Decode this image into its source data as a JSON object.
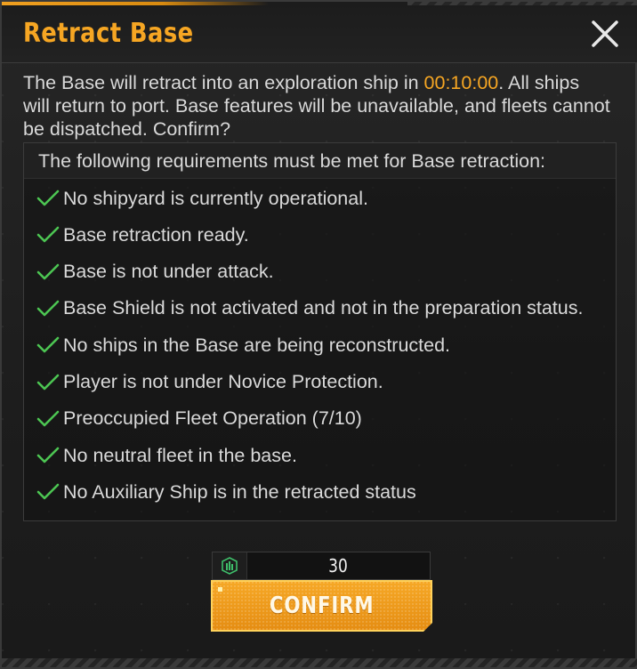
{
  "dialog": {
    "title": "Retract Base",
    "close_icon": "close-icon",
    "message": {
      "part1": "The Base will retract into an exploration ship in ",
      "timer": "00:10:00",
      "part2": ". All ships will return to port. Base features will be unavailable, and fleets cannot be dispatched. Confirm?"
    },
    "requirements": {
      "title": "The following requirements must be met for Base retraction:",
      "items": [
        {
          "label": "No shipyard is currently operational.",
          "icon": "check-icon"
        },
        {
          "label": "Base retraction ready.",
          "icon": "check-icon"
        },
        {
          "label": "Base is not under attack.",
          "icon": "check-icon"
        },
        {
          "label": "Base Shield is not activated and not in the preparation status.",
          "icon": "check-icon"
        },
        {
          "label": "No ships in the Base are being reconstructed.",
          "icon": "check-icon"
        },
        {
          "label": "Player is not under Novice Protection.",
          "icon": "check-icon"
        },
        {
          "label": "Preoccupied Fleet Operation (7/10)",
          "icon": "check-icon"
        },
        {
          "label": "No neutral fleet in the base.",
          "icon": "check-icon"
        },
        {
          "label": "No Auxiliary Ship is in the retracted status",
          "icon": "check-icon"
        }
      ]
    },
    "cost": {
      "icon": "resource-icon",
      "value": "30"
    },
    "confirm_label": "CONFIRM"
  },
  "colors": {
    "accent": "#f6a623",
    "check": "#4cc552",
    "resource": "#3fbf6a"
  }
}
